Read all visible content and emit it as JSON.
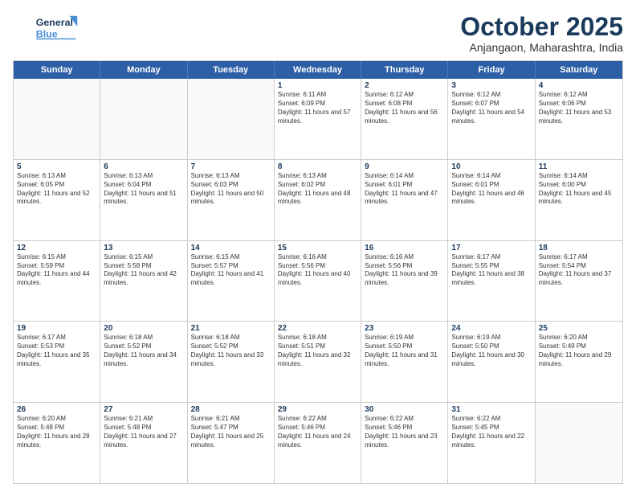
{
  "header": {
    "logo_line1": "General",
    "logo_line2": "Blue",
    "month": "October 2025",
    "location": "Anjangaon, Maharashtra, India"
  },
  "weekdays": [
    "Sunday",
    "Monday",
    "Tuesday",
    "Wednesday",
    "Thursday",
    "Friday",
    "Saturday"
  ],
  "weeks": [
    [
      {
        "day": "",
        "sunrise": "",
        "sunset": "",
        "daylight": ""
      },
      {
        "day": "",
        "sunrise": "",
        "sunset": "",
        "daylight": ""
      },
      {
        "day": "",
        "sunrise": "",
        "sunset": "",
        "daylight": ""
      },
      {
        "day": "1",
        "sunrise": "Sunrise: 6:11 AM",
        "sunset": "Sunset: 6:09 PM",
        "daylight": "Daylight: 11 hours and 57 minutes."
      },
      {
        "day": "2",
        "sunrise": "Sunrise: 6:12 AM",
        "sunset": "Sunset: 6:08 PM",
        "daylight": "Daylight: 11 hours and 56 minutes."
      },
      {
        "day": "3",
        "sunrise": "Sunrise: 6:12 AM",
        "sunset": "Sunset: 6:07 PM",
        "daylight": "Daylight: 11 hours and 54 minutes."
      },
      {
        "day": "4",
        "sunrise": "Sunrise: 6:12 AM",
        "sunset": "Sunset: 6:06 PM",
        "daylight": "Daylight: 11 hours and 53 minutes."
      }
    ],
    [
      {
        "day": "5",
        "sunrise": "Sunrise: 6:13 AM",
        "sunset": "Sunset: 6:05 PM",
        "daylight": "Daylight: 11 hours and 52 minutes."
      },
      {
        "day": "6",
        "sunrise": "Sunrise: 6:13 AM",
        "sunset": "Sunset: 6:04 PM",
        "daylight": "Daylight: 11 hours and 51 minutes."
      },
      {
        "day": "7",
        "sunrise": "Sunrise: 6:13 AM",
        "sunset": "Sunset: 6:03 PM",
        "daylight": "Daylight: 11 hours and 50 minutes."
      },
      {
        "day": "8",
        "sunrise": "Sunrise: 6:13 AM",
        "sunset": "Sunset: 6:02 PM",
        "daylight": "Daylight: 11 hours and 48 minutes."
      },
      {
        "day": "9",
        "sunrise": "Sunrise: 6:14 AM",
        "sunset": "Sunset: 6:01 PM",
        "daylight": "Daylight: 11 hours and 47 minutes."
      },
      {
        "day": "10",
        "sunrise": "Sunrise: 6:14 AM",
        "sunset": "Sunset: 6:01 PM",
        "daylight": "Daylight: 11 hours and 46 minutes."
      },
      {
        "day": "11",
        "sunrise": "Sunrise: 6:14 AM",
        "sunset": "Sunset: 6:00 PM",
        "daylight": "Daylight: 11 hours and 45 minutes."
      }
    ],
    [
      {
        "day": "12",
        "sunrise": "Sunrise: 6:15 AM",
        "sunset": "Sunset: 5:59 PM",
        "daylight": "Daylight: 11 hours and 44 minutes."
      },
      {
        "day": "13",
        "sunrise": "Sunrise: 6:15 AM",
        "sunset": "Sunset: 5:58 PM",
        "daylight": "Daylight: 11 hours and 42 minutes."
      },
      {
        "day": "14",
        "sunrise": "Sunrise: 6:15 AM",
        "sunset": "Sunset: 5:57 PM",
        "daylight": "Daylight: 11 hours and 41 minutes."
      },
      {
        "day": "15",
        "sunrise": "Sunrise: 6:16 AM",
        "sunset": "Sunset: 5:56 PM",
        "daylight": "Daylight: 11 hours and 40 minutes."
      },
      {
        "day": "16",
        "sunrise": "Sunrise: 6:16 AM",
        "sunset": "Sunset: 5:56 PM",
        "daylight": "Daylight: 11 hours and 39 minutes."
      },
      {
        "day": "17",
        "sunrise": "Sunrise: 6:17 AM",
        "sunset": "Sunset: 5:55 PM",
        "daylight": "Daylight: 11 hours and 38 minutes."
      },
      {
        "day": "18",
        "sunrise": "Sunrise: 6:17 AM",
        "sunset": "Sunset: 5:54 PM",
        "daylight": "Daylight: 11 hours and 37 minutes."
      }
    ],
    [
      {
        "day": "19",
        "sunrise": "Sunrise: 6:17 AM",
        "sunset": "Sunset: 5:53 PM",
        "daylight": "Daylight: 11 hours and 35 minutes."
      },
      {
        "day": "20",
        "sunrise": "Sunrise: 6:18 AM",
        "sunset": "Sunset: 5:52 PM",
        "daylight": "Daylight: 11 hours and 34 minutes."
      },
      {
        "day": "21",
        "sunrise": "Sunrise: 6:18 AM",
        "sunset": "Sunset: 5:52 PM",
        "daylight": "Daylight: 11 hours and 33 minutes."
      },
      {
        "day": "22",
        "sunrise": "Sunrise: 6:18 AM",
        "sunset": "Sunset: 5:51 PM",
        "daylight": "Daylight: 11 hours and 32 minutes."
      },
      {
        "day": "23",
        "sunrise": "Sunrise: 6:19 AM",
        "sunset": "Sunset: 5:50 PM",
        "daylight": "Daylight: 11 hours and 31 minutes."
      },
      {
        "day": "24",
        "sunrise": "Sunrise: 6:19 AM",
        "sunset": "Sunset: 5:50 PM",
        "daylight": "Daylight: 11 hours and 30 minutes."
      },
      {
        "day": "25",
        "sunrise": "Sunrise: 6:20 AM",
        "sunset": "Sunset: 5:49 PM",
        "daylight": "Daylight: 11 hours and 29 minutes."
      }
    ],
    [
      {
        "day": "26",
        "sunrise": "Sunrise: 6:20 AM",
        "sunset": "Sunset: 5:48 PM",
        "daylight": "Daylight: 11 hours and 28 minutes."
      },
      {
        "day": "27",
        "sunrise": "Sunrise: 6:21 AM",
        "sunset": "Sunset: 5:48 PM",
        "daylight": "Daylight: 11 hours and 27 minutes."
      },
      {
        "day": "28",
        "sunrise": "Sunrise: 6:21 AM",
        "sunset": "Sunset: 5:47 PM",
        "daylight": "Daylight: 11 hours and 25 minutes."
      },
      {
        "day": "29",
        "sunrise": "Sunrise: 6:22 AM",
        "sunset": "Sunset: 5:46 PM",
        "daylight": "Daylight: 11 hours and 24 minutes."
      },
      {
        "day": "30",
        "sunrise": "Sunrise: 6:22 AM",
        "sunset": "Sunset: 5:46 PM",
        "daylight": "Daylight: 11 hours and 23 minutes."
      },
      {
        "day": "31",
        "sunrise": "Sunrise: 6:22 AM",
        "sunset": "Sunset: 5:45 PM",
        "daylight": "Daylight: 11 hours and 22 minutes."
      },
      {
        "day": "",
        "sunrise": "",
        "sunset": "",
        "daylight": ""
      }
    ]
  ]
}
